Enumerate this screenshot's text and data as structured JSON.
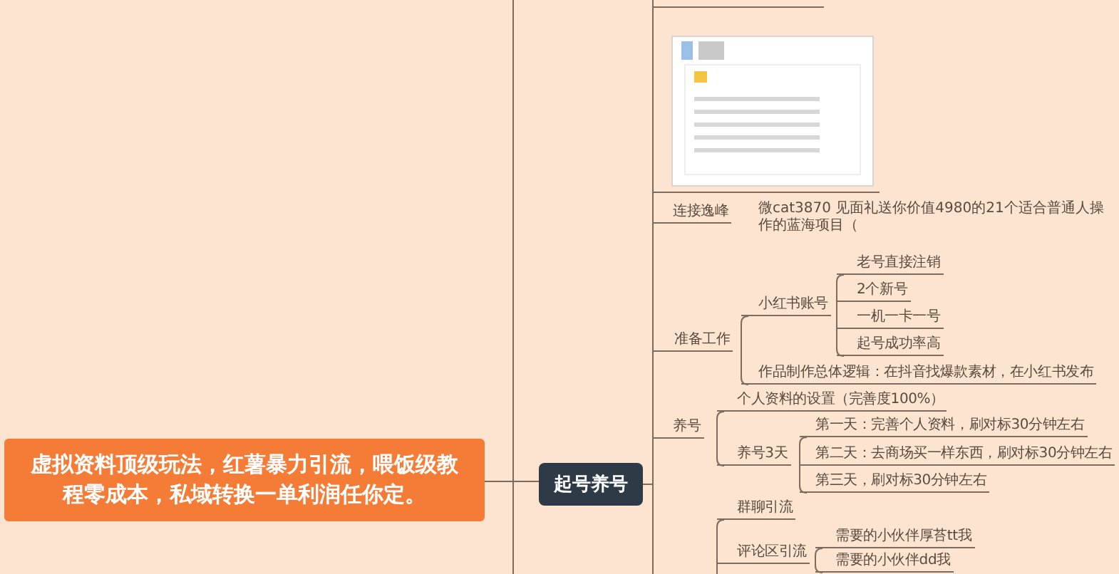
{
  "central_topic": "虚拟资料顶级玩法，红薯暴力引流，喂饭级教程零成本，私域转换一单利润任你定。",
  "main_branch": "起号养号",
  "branches": [
    {
      "label": "连接逸峰",
      "children": [
        {
          "label": "微cat3870 见面礼送你价值4980的21个适合普通人操作的蓝海项目（",
          "kind": "note"
        }
      ]
    },
    {
      "label": "准备工作",
      "children": [
        {
          "label": "小红书账号",
          "children": [
            {
              "label": "老号直接注销"
            },
            {
              "label": "2个新号"
            },
            {
              "label": "一机一卡一号"
            },
            {
              "label": "起号成功率高"
            }
          ]
        },
        {
          "label": "作品制作总体逻辑：在抖音找爆款素材，在小红书发布"
        }
      ]
    },
    {
      "label": "养号",
      "children": [
        {
          "label": "个人资料的设置（完善度100%）"
        },
        {
          "label": "养号3天",
          "children": [
            {
              "label": "第一天：完善个人资料，刷对标30分钟左右"
            },
            {
              "label": "第二天：去商场买一样东西，刷对标30分钟左右"
            },
            {
              "label": "第三天，刷对标30分钟左右"
            }
          ]
        }
      ]
    },
    {
      "children": [
        {
          "label": "群聊引流"
        },
        {
          "label": "评论区引流",
          "children": [
            {
              "label": "需要的小伙伴厚苔tt我"
            },
            {
              "label": "需要的小伙伴dd我"
            }
          ]
        }
      ]
    }
  ]
}
